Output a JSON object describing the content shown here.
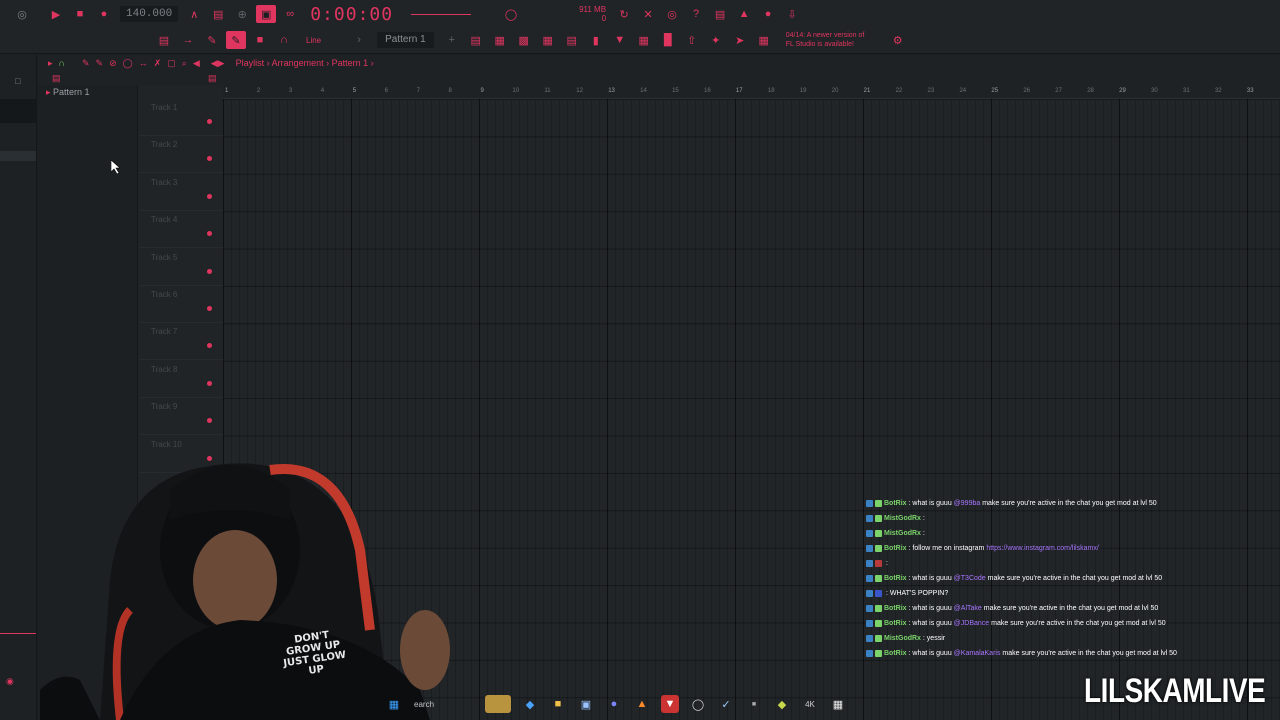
{
  "toolbar": {
    "tempo": "140.000",
    "time": "0:00:00",
    "memory": "911 MB",
    "memory_sub": "0",
    "pattern": "Pattern 1",
    "snap": "Line",
    "news_line1": "04/14: A newer version of",
    "news_line2": "FL Studio is available!"
  },
  "playlist": {
    "title_prefix": "Playlist",
    "title_view": "Arrangement",
    "title_pattern": "Pattern 1",
    "pattern_list": [
      "Pattern 1"
    ],
    "tracks": [
      "Track 1",
      "Track 2",
      "Track 3",
      "Track 4",
      "Track 5",
      "Track 6",
      "Track 7",
      "Track 8",
      "Track 9",
      "Track 10"
    ],
    "bar_numbers": [
      1,
      2,
      3,
      4,
      5,
      6,
      7,
      8,
      9,
      10,
      11,
      12,
      13,
      14,
      15,
      16,
      17,
      18,
      19,
      20,
      21,
      22,
      23,
      24,
      25,
      26,
      27,
      28,
      29,
      30,
      31,
      32,
      33
    ]
  },
  "chat": [
    {
      "user": "BotRix",
      "user_color": "#7bd36b",
      "msg": "what is guuu",
      "mention": "@999ba",
      "rest": "make sure you're active in the chat you get mod at lvl 50"
    },
    {
      "user": "MistGodRx",
      "user_color": "#7bd36b",
      "msg": "",
      "mention": "",
      "rest": ""
    },
    {
      "user": "MistGodRx",
      "user_color": "#7bd36b",
      "msg": "",
      "mention": "",
      "rest": ""
    },
    {
      "user": "BotRix",
      "user_color": "#7bd36b",
      "msg": "follow me on instagram",
      "mention": "https://www.instagram.com/lilskamx/",
      "rest": ""
    },
    {
      "user": "",
      "user_color": "#b83a3a",
      "msg": "",
      "mention": "",
      "rest": ""
    },
    {
      "user": "BotRix",
      "user_color": "#7bd36b",
      "msg": "what is guuu",
      "mention": "@T3Code",
      "rest": "make sure you're active in the chat you get mod at lvl 50"
    },
    {
      "user": "",
      "user_color": "#3a55c9",
      "msg": "WHAT'S POPPIN?",
      "mention": "",
      "rest": ""
    },
    {
      "user": "BotRix",
      "user_color": "#7bd36b",
      "msg": "what is guuu",
      "mention": "@AlTake",
      "rest": "make sure you're active in the chat you get mod at lvl 50"
    },
    {
      "user": "BotRix",
      "user_color": "#7bd36b",
      "msg": "what is guuu",
      "mention": "@JDBance",
      "rest": "make sure you're active in the chat you get mod at lvl 50"
    },
    {
      "user": "MistGodRx",
      "user_color": "#7bd36b",
      "msg": "yessir",
      "mention": "",
      "rest": ""
    },
    {
      "user": "BotRix",
      "user_color": "#7bd36b",
      "msg": "what is guuu",
      "mention": "@KamalaKaris",
      "rest": "make sure you're active in the chat you get mod at lvl 50"
    }
  ],
  "taskbar": {
    "search_label": "earch"
  },
  "watermark": "LILSKAMLIVE",
  "shirt_text": "DON'T GROW UP JUST GLOW UP",
  "colors": {
    "accent": "#e0355f",
    "background": "#1e2225",
    "chat_user": "#7bd36b",
    "chat_link": "#a875ff"
  }
}
